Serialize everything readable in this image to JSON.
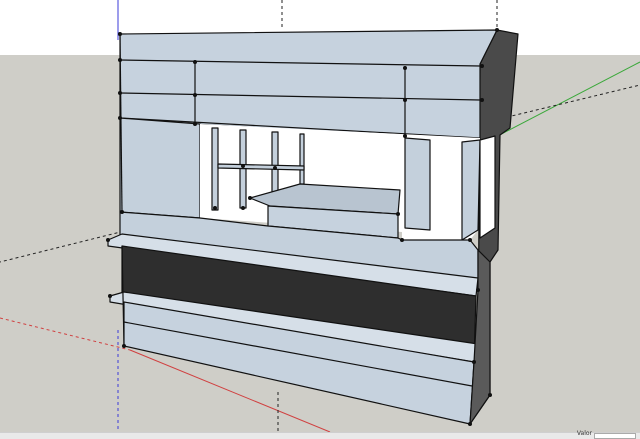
{
  "viewport": {
    "sky_color": "#ffffff",
    "ground_color": "#cfcec8",
    "axes": {
      "red": "#d04040",
      "green": "#3aa83a",
      "blue": "#3b3bd8"
    }
  },
  "model": {
    "face_color": "#c4d0dc",
    "face_light": "#d2dce6",
    "side_dark": "#4a4a4a",
    "panel_dark": "#2e2e2e",
    "edge_color": "#111111"
  },
  "statusbar": {
    "measure_label": "Valor"
  }
}
